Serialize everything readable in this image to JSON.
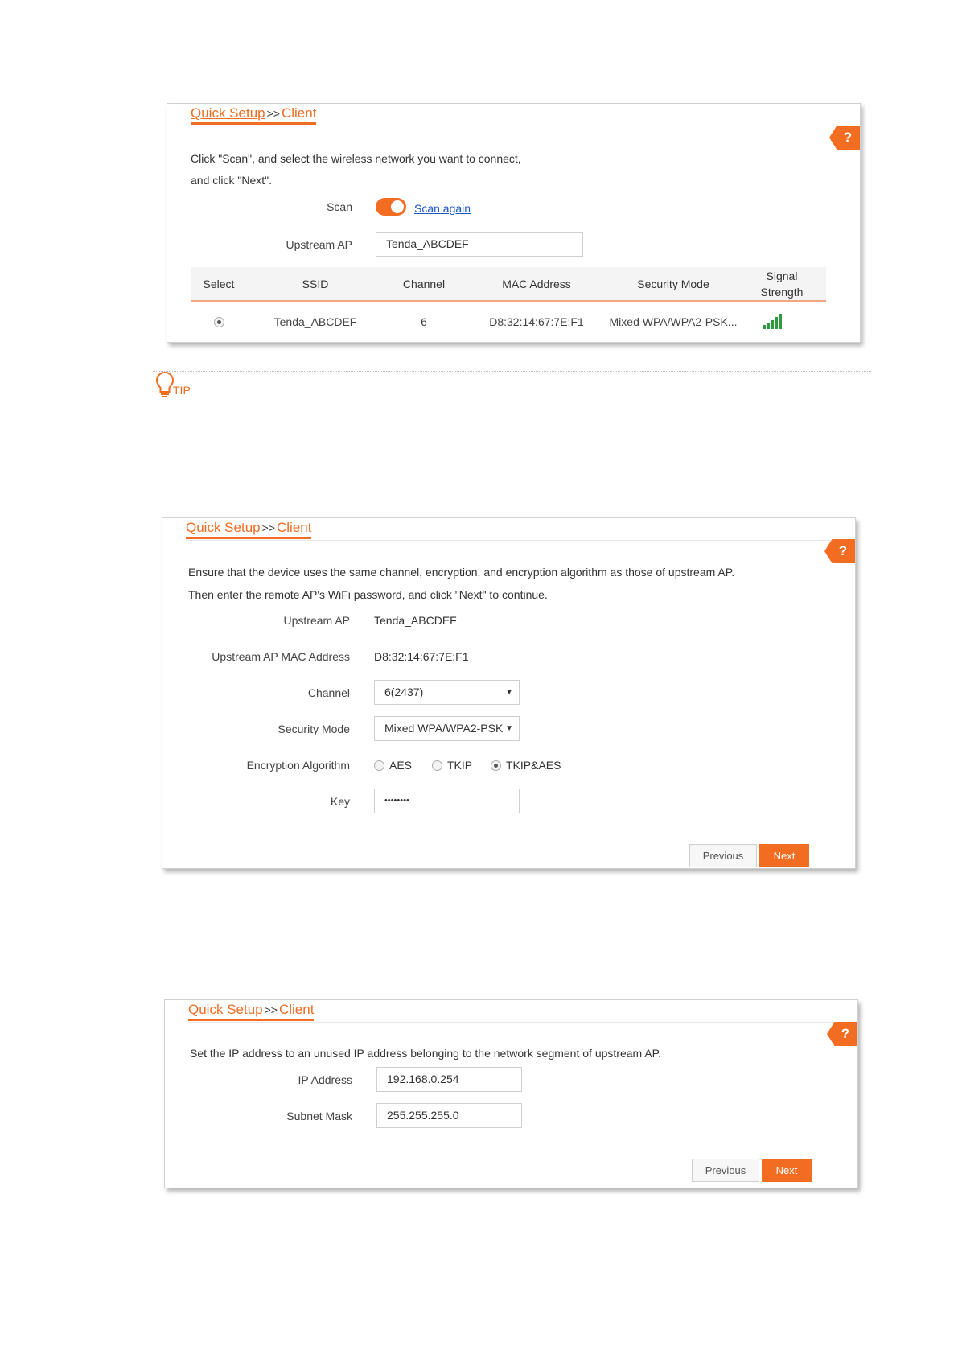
{
  "common": {
    "breadcrumb_quick": "Quick Setup",
    "breadcrumb_sep": ">>",
    "breadcrumb_client": "Client",
    "help": "?",
    "accent": "#f26c22"
  },
  "step1": {
    "instruction_line1": "Click \"Scan\", and select the wireless network you want to connect,",
    "instruction_line2": "and click \"Next\".",
    "scan_label": "Scan",
    "scan_on": true,
    "scan_again": "Scan again",
    "upstream_label": "Upstream AP",
    "upstream_value": "Tenda_ABCDEF",
    "table": {
      "headers": [
        "Select",
        "SSID",
        "Channel",
        "MAC Address",
        "Security Mode",
        "Signal Strength"
      ],
      "row": {
        "ssid": "Tenda_ABCDEF",
        "channel": "6",
        "mac": "D8:32:14:67:7E:F1",
        "security": "Mixed WPA/WPA2-PSK...",
        "signal_bars": 5
      }
    }
  },
  "tip": {
    "label": "TIP"
  },
  "step2": {
    "instruction_line1": "Ensure that the device uses the same channel, encryption, and encryption algorithm as those of upstream AP.",
    "instruction_line2": "Then enter the remote AP's WiFi password, and click \"Next\" to continue.",
    "upstream_label": "Upstream AP",
    "upstream_value": "Tenda_ABCDEF",
    "mac_label": "Upstream AP MAC Address",
    "mac_value": "D8:32:14:67:7E:F1",
    "channel_label": "Channel",
    "channel_value": "6(2437)",
    "security_label": "Security Mode",
    "security_value": "Mixed WPA/WPA2-PSK",
    "algo_label": "Encryption Algorithm",
    "algo_options": [
      "AES",
      "TKIP",
      "TKIP&AES"
    ],
    "algo_selected": "TKIP&AES",
    "key_label": "Key",
    "key_value": "••••••••",
    "previous": "Previous",
    "next": "Next"
  },
  "step3": {
    "instruction": "Set the IP address to an unused IP address belonging to the network segment of upstream AP.",
    "ip_label": "IP Address",
    "ip_value": "192.168.0.254",
    "mask_label": "Subnet Mask",
    "mask_value": "255.255.255.0",
    "previous": "Previous",
    "next": "Next"
  }
}
